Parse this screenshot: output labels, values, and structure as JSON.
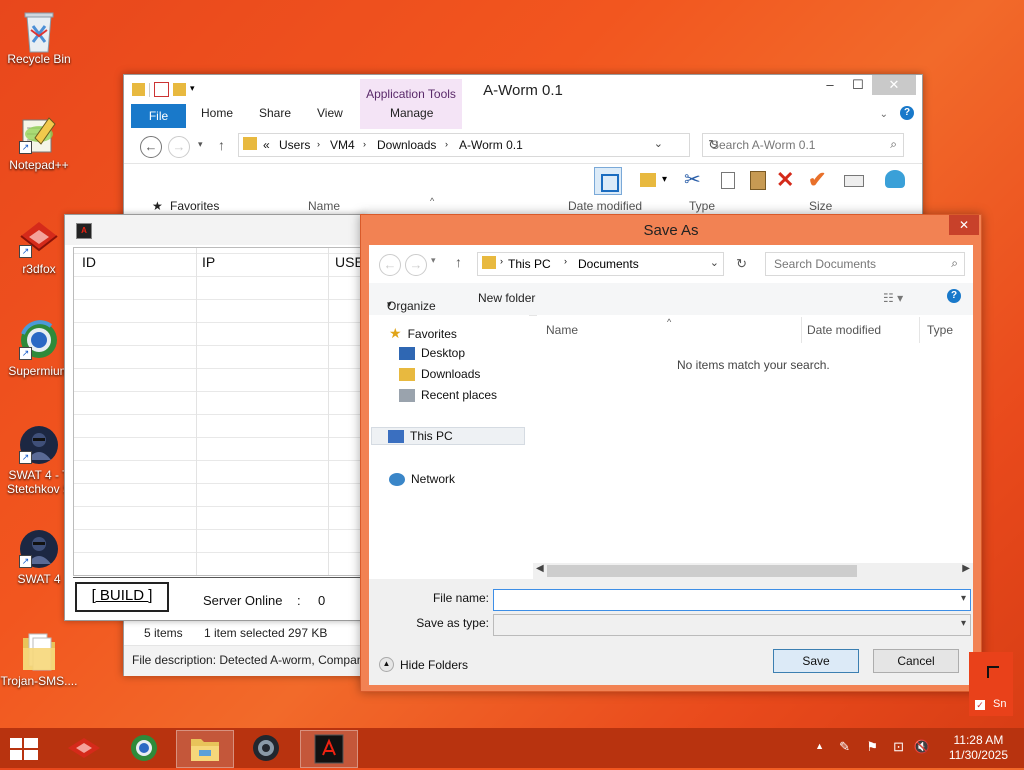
{
  "desktop": {
    "icons": [
      {
        "label": "Recycle Bin"
      },
      {
        "label": "Notepad++"
      },
      {
        "label": "r3dfox"
      },
      {
        "label": "Supermium"
      },
      {
        "label": "SWAT 4 - T",
        "label2": "Stetchkov S"
      },
      {
        "label": "SWAT 4"
      },
      {
        "label": "Trojan-SMS...."
      }
    ]
  },
  "explorer": {
    "title": "A-Worm 0.1",
    "context_tab": "Application Tools",
    "tabs": [
      "File",
      "Home",
      "Share",
      "View",
      "Manage"
    ],
    "breadcrumb": [
      "«",
      "Users",
      "VM4",
      "Downloads",
      "A-Worm 0.1"
    ],
    "search_placeholder": "Search A-Worm 0.1",
    "columns": [
      "Name",
      "Date modified",
      "Type",
      "Size"
    ],
    "nav_first": "Favorites",
    "status_items": "5 items",
    "status_selected": "1 item selected",
    "status_size": "297 KB",
    "file_description": "File description: Detected A-worm, Company"
  },
  "aworm": {
    "columns": [
      "ID",
      "IP",
      "USE"
    ],
    "build_label": "[ BUILD ]",
    "server_label": "Server Online",
    "server_sep": ":",
    "server_count": "0"
  },
  "saveas": {
    "title": "Save As",
    "breadcrumb": [
      "This PC",
      "Documents"
    ],
    "search_placeholder": "Search Documents",
    "organize": "Organize",
    "new_folder": "New folder",
    "nav": {
      "favorites": "Favorites",
      "desktop": "Desktop",
      "downloads": "Downloads",
      "recent": "Recent places",
      "thispc": "This PC",
      "network": "Network"
    },
    "columns": [
      "Name",
      "Date modified",
      "Type"
    ],
    "empty_message": "No items match your search.",
    "file_name_label": "File name:",
    "file_name_value": "",
    "save_type_label": "Save as type:",
    "save_type_value": "",
    "hide_folders": "Hide Folders",
    "save_button": "Save",
    "cancel_button": "Cancel"
  },
  "taskbar": {
    "time": "11:28 AM",
    "date": "11/30/2025",
    "ghost_label": "Sn"
  },
  "colors": {
    "desktop": "#ee5420",
    "taskbar": "#b8330f",
    "accent": "#1979ca",
    "dialog_frame": "#f28253"
  }
}
